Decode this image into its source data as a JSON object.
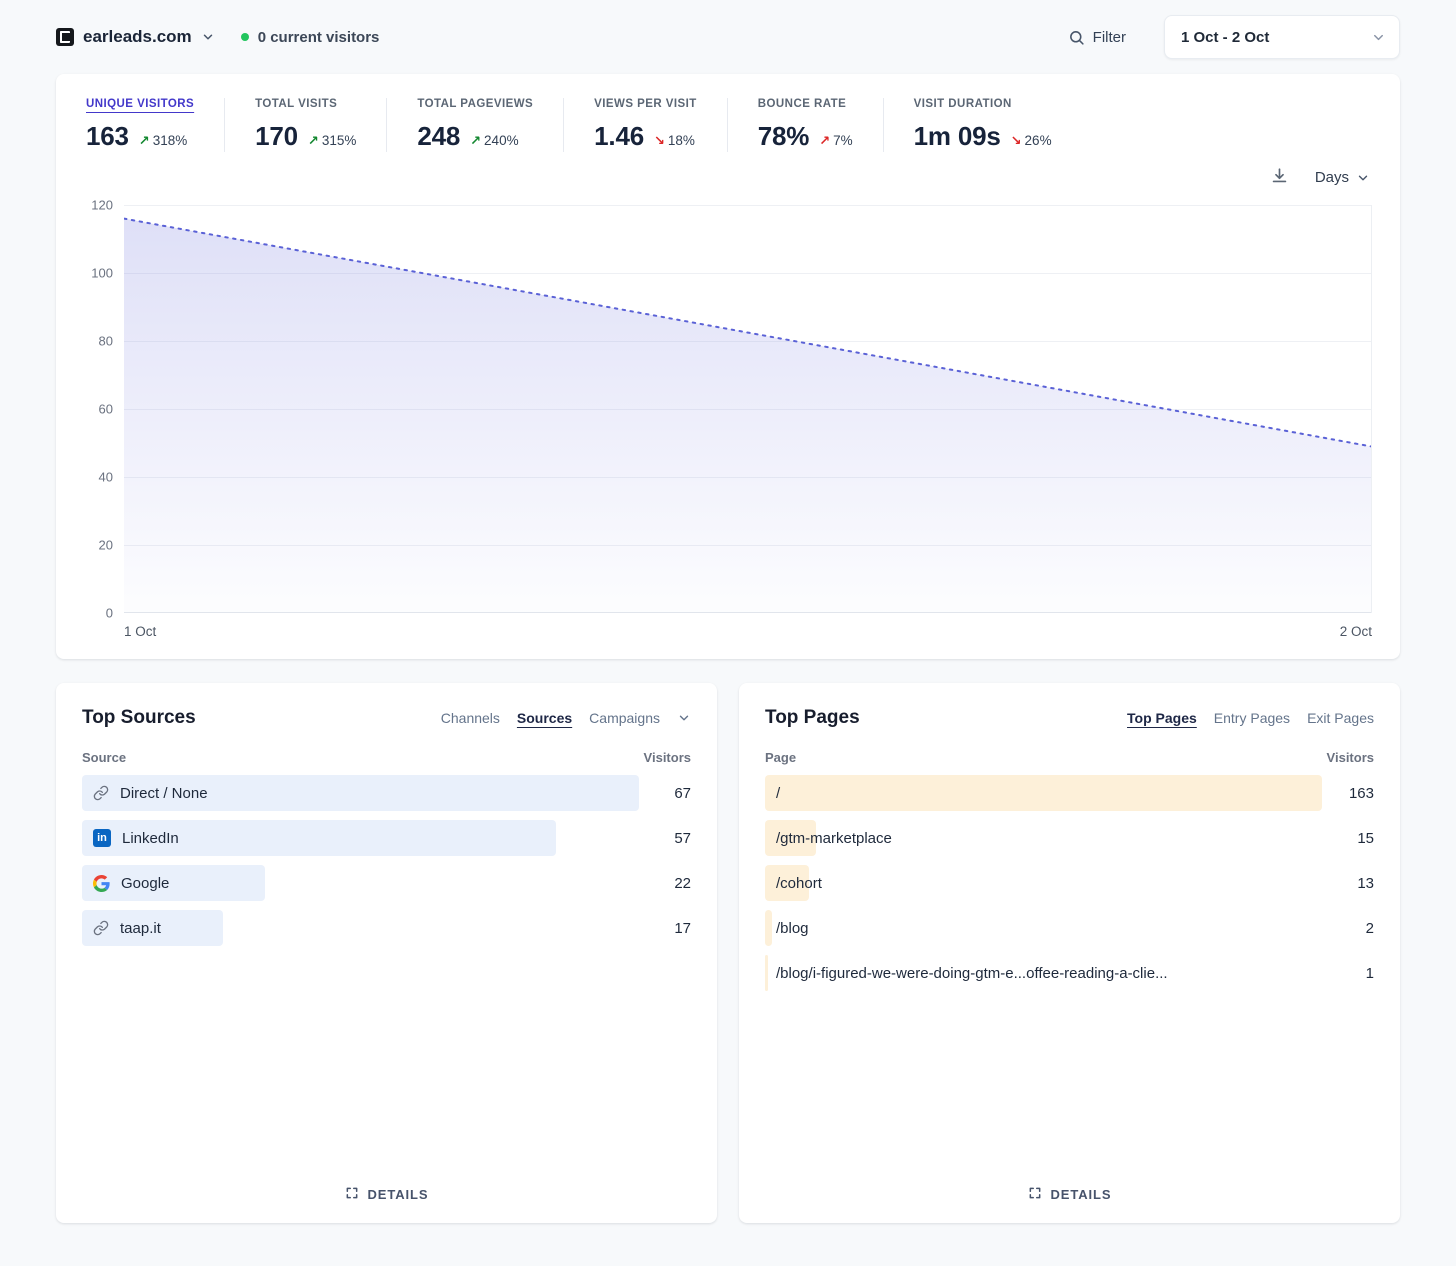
{
  "header": {
    "site_name": "earleads.com",
    "visitors_status": "0 current visitors",
    "filter_label": "Filter",
    "date_range": "1 Oct - 2 Oct"
  },
  "stats": [
    {
      "label": "UNIQUE VISITORS",
      "value": "163",
      "arrow": "↗",
      "change": "318%",
      "sentiment": "good",
      "active": true
    },
    {
      "label": "TOTAL VISITS",
      "value": "170",
      "arrow": "↗",
      "change": "315%",
      "sentiment": "good",
      "active": false
    },
    {
      "label": "TOTAL PAGEVIEWS",
      "value": "248",
      "arrow": "↗",
      "change": "240%",
      "sentiment": "good",
      "active": false
    },
    {
      "label": "VIEWS PER VISIT",
      "value": "1.46",
      "arrow": "↘",
      "change": "18%",
      "sentiment": "bad",
      "active": false
    },
    {
      "label": "BOUNCE RATE",
      "value": "78%",
      "arrow": "↗",
      "change": "7%",
      "sentiment": "bad",
      "active": false
    },
    {
      "label": "VISIT DURATION",
      "value": "1m 09s",
      "arrow": "↘",
      "change": "26%",
      "sentiment": "bad",
      "active": false
    }
  ],
  "chart_data": {
    "type": "area",
    "x": [
      "1 Oct",
      "2 Oct"
    ],
    "series": [
      {
        "name": "Unique visitors",
        "values": [
          116,
          49
        ]
      }
    ],
    "ylim": [
      0,
      120
    ],
    "yticks_top_to_bottom": [
      "120",
      "100",
      "80",
      "60",
      "40",
      "20",
      "0"
    ],
    "line_style": "dotted",
    "grid": "horizontal",
    "interval_label": "Days"
  },
  "top_sources": {
    "title": "Top Sources",
    "tabs": [
      "Channels",
      "Sources",
      "Campaigns"
    ],
    "active_tab": "Sources",
    "col_left": "Source",
    "col_right": "Visitors",
    "rows": [
      {
        "label": "Direct / None",
        "icon": "link-icon",
        "visitors": 67
      },
      {
        "label": "LinkedIn",
        "icon": "linkedin-icon",
        "visitors": 57
      },
      {
        "label": "Google",
        "icon": "google-icon",
        "visitors": 22
      },
      {
        "label": "taap.it",
        "icon": "link-icon",
        "visitors": 17
      }
    ],
    "details_label": "DETAILS"
  },
  "top_pages": {
    "title": "Top Pages",
    "tabs": [
      "Top Pages",
      "Entry Pages",
      "Exit Pages"
    ],
    "active_tab": "Top Pages",
    "col_left": "Page",
    "col_right": "Visitors",
    "rows": [
      {
        "label": "/",
        "visitors": 163
      },
      {
        "label": "/gtm-marketplace",
        "visitors": 15
      },
      {
        "label": "/cohort",
        "visitors": 13
      },
      {
        "label": "/blog",
        "visitors": 2
      },
      {
        "label": "/blog/i-figured-we-were-doing-gtm-e...offee-reading-a-clie...",
        "visitors": 1
      }
    ],
    "details_label": "DETAILS"
  },
  "colors": {
    "accent": "#4338ca",
    "positive": "#12872f",
    "negative": "#dc2626",
    "chart_line": "#5a61d6",
    "chart_fill": "#8b8fe3",
    "source_bar": "#e9f0fb",
    "page_bar": "#fdf0d9",
    "online_dot": "#22c55e",
    "linkedin_blue": "#0a66c2"
  }
}
